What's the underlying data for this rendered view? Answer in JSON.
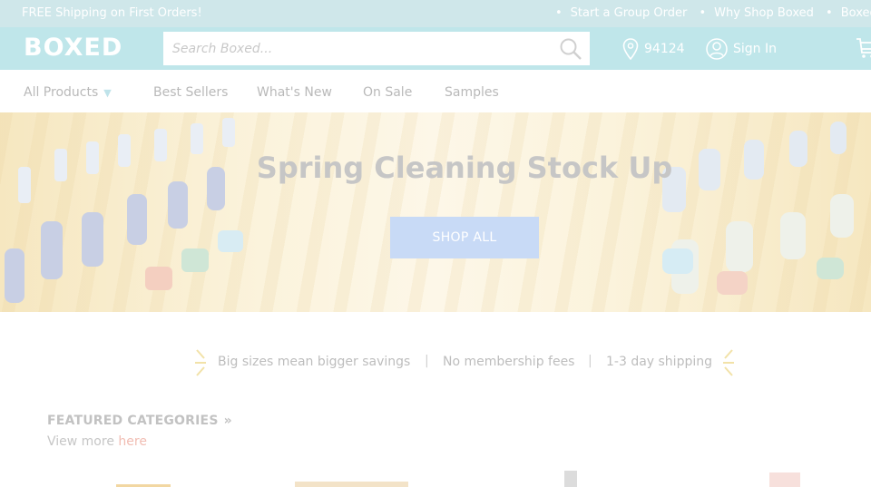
{
  "topbar": {
    "promo": "FREE Shipping on First Orders!",
    "links": [
      "Start a Group Order",
      "Why Shop Boxed",
      "Boxed for B"
    ]
  },
  "header": {
    "logo": "BOXED",
    "search_placeholder": "Search Boxed...",
    "zip": "94124",
    "signin": "Sign In"
  },
  "nav": {
    "items": [
      "All Products",
      "Best Sellers",
      "What's New",
      "On Sale",
      "Samples"
    ]
  },
  "hero": {
    "title": "Spring Cleaning Stock Up",
    "button": "SHOP ALL"
  },
  "value_props": [
    "Big sizes mean bigger savings",
    "No membership fees",
    "1-3 day shipping"
  ],
  "featured": {
    "heading": "FEATURED CATEGORIES",
    "view_more_prefix": "View more ",
    "view_more_link": "here"
  },
  "colors": {
    "header_bg": "#bfe6ea",
    "topbar_bg": "#cfe7ea",
    "button_bg": "#c8daf6",
    "link_accent": "#f1bdb3"
  }
}
